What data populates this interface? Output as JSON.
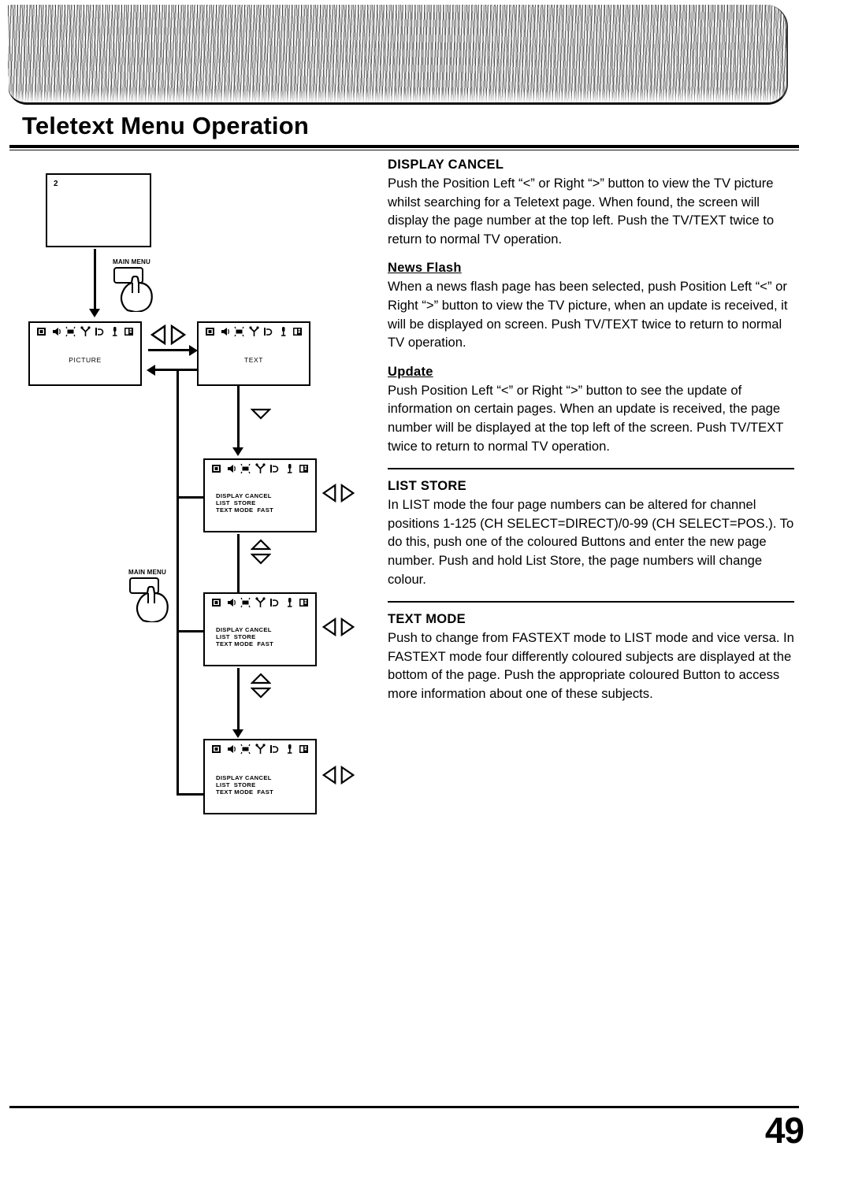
{
  "document": {
    "title": "Teletext Menu Operation",
    "page_number": "49"
  },
  "diagram": {
    "screens": {
      "top": {
        "corner_number": "2",
        "label": ""
      },
      "picture": {
        "label": "PICTURE"
      },
      "text": {
        "label": "TEXT"
      }
    },
    "menu_screen": {
      "line1": "DISPLAY CANCEL",
      "line2": "LIST  STORE",
      "line3": "TEXT MODE  FAST"
    },
    "buttons": {
      "main_menu_1": "MAIN MENU",
      "main_menu_2": "MAIN MENU"
    },
    "icons": {
      "position_left": "position-left-triangle-icon",
      "position_right": "position-right-triangle-icon",
      "up": "up-triangle-icon",
      "down": "down-triangle-icon",
      "osd_row": [
        "picture-icon",
        "speaker-icon",
        "dsp-icon",
        "antenna-icon",
        "sound-icon",
        "microphone-icon",
        "setup-icon"
      ]
    }
  },
  "sections": [
    {
      "heading": "DISPLAY CANCEL",
      "underline": false,
      "body": "Push the Position Left “<” or Right “>” button to view the TV picture whilst searching for a Teletext page. When found, the screen will display the page number at the top left.\nPush the TV/TEXT twice to return to normal TV operation."
    },
    {
      "heading": "News Flash",
      "underline": true,
      "body": "When a news flash page has been selected, push Position Left “<” or Right “>” button to view the TV picture, when an update is received, it will be displayed on screen.\nPush TV/TEXT twice to return to normal TV operation."
    },
    {
      "heading": "Update",
      "underline": true,
      "body": "Push Position Left “<” or Right “>” button to see the update of information on certain pages. When an update is received, the page number will be displayed at the top left of the screen.\nPush TV/TEXT twice to return to normal TV operation."
    },
    {
      "heading": "LIST STORE",
      "underline": false,
      "body": "In LIST mode the four page numbers can be altered for channel positions 1-125 (CH SELECT=DIRECT)/0-99 (CH SELECT=POS.). To do this, push one of the coloured Buttons and enter the new page number.\nPush and hold List Store, the page numbers will change colour."
    },
    {
      "heading": "TEXT MODE",
      "underline": false,
      "body": "Push to change from FASTEXT mode to LIST mode and vice versa.\nIn FASTEXT mode four differently coloured subjects are displayed at the bottom of the page. Push the appropriate coloured Button to access more information about one of these subjects."
    }
  ]
}
